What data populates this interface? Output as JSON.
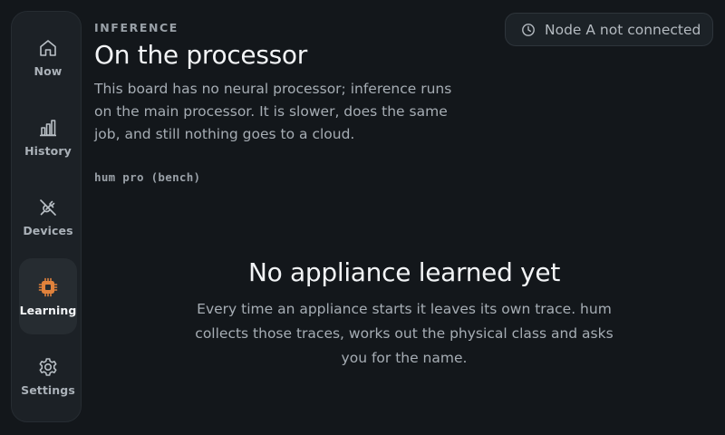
{
  "nav": {
    "items": [
      {
        "label": "Now",
        "icon": "home-icon"
      },
      {
        "label": "History",
        "icon": "bar-chart-icon"
      },
      {
        "label": "Devices",
        "icon": "unplugged-icon"
      },
      {
        "label": "Learning",
        "icon": "chip-icon",
        "active": true
      },
      {
        "label": "Settings",
        "icon": "gear-icon"
      }
    ]
  },
  "header": {
    "eyebrow": "INFERENCE",
    "title": "On the processor",
    "description": "This board has no neural processor; inference runs on the main processor. It is slower, does the same job, and still nothing goes to a cloud.",
    "model_tag": "hum pro (bench)"
  },
  "status": {
    "label": "Node A not connected",
    "icon": "clock-icon"
  },
  "empty_state": {
    "title": "No appliance learned yet",
    "text": "Every time an appliance starts it leaves its own trace. hum collects those traces, works out the physical class and asks you for the name."
  },
  "colors": {
    "background": "#13171b",
    "sidebar": "#1c2126",
    "accent": "#e0823c",
    "text_primary": "#f2f4f6",
    "text_secondary": "#a6adb4"
  }
}
